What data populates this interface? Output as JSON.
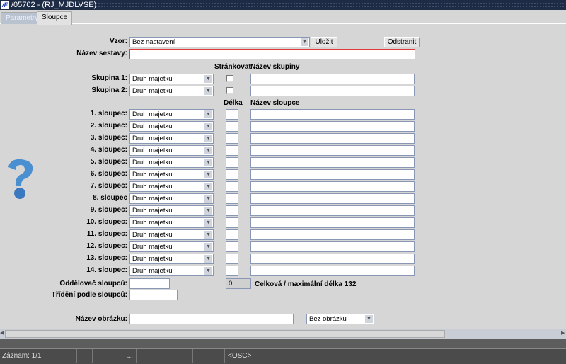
{
  "window": {
    "title": "/05702 - (RJ_MJDLVSE)",
    "logo": "IF"
  },
  "tabs": [
    {
      "label": "Parametry",
      "active": false
    },
    {
      "label": "Sloupce",
      "active": true
    }
  ],
  "form": {
    "vzor_label": "Vzor:",
    "vzor_value": "Bez nastavení",
    "save_label": "Uložit",
    "delete_label": "Odstranit",
    "nazev_sestavy_label": "Název sestavy:",
    "nazev_sestavy_value": "",
    "hdr_strankovat": "Stránkovat",
    "hdr_nazev_skupiny": "Název skupiny",
    "groups": [
      {
        "label": "Skupina 1:",
        "value": "Druh majetku",
        "page": false,
        "name": ""
      },
      {
        "label": "Skupina 2:",
        "value": "Druh majetku",
        "page": false,
        "name": ""
      }
    ],
    "hdr_delka": "Délka",
    "hdr_nazev_sloupce": "Název sloupce",
    "columns": [
      {
        "label": "1. sloupec:",
        "value": "Druh majetku"
      },
      {
        "label": "2. sloupec:",
        "value": "Druh majetku"
      },
      {
        "label": "3. sloupec:",
        "value": "Druh majetku"
      },
      {
        "label": "4. sloupec:",
        "value": "Druh majetku"
      },
      {
        "label": "5. sloupec:",
        "value": "Druh majetku"
      },
      {
        "label": "6. sloupec:",
        "value": "Druh majetku"
      },
      {
        "label": "7. sloupec:",
        "value": "Druh majetku"
      },
      {
        "label": "8. sloupec",
        "value": "Druh majetku"
      },
      {
        "label": "9. sloupec:",
        "value": "Druh majetku"
      },
      {
        "label": "10. sloupec:",
        "value": "Druh majetku"
      },
      {
        "label": "11. sloupec:",
        "value": "Druh majetku"
      },
      {
        "label": "12. sloupec:",
        "value": "Druh majetku"
      },
      {
        "label": "13. sloupec:",
        "value": "Druh majetku"
      },
      {
        "label": "14. sloupec:",
        "value": "Druh majetku"
      }
    ],
    "oddelovac_label": "Oddělovač sloupců:",
    "oddelovac_value": "",
    "celkova_value": "0",
    "celkova_label": "Celková  / maximální délka 132",
    "trideni_label": "Třídění podle sloupců:",
    "trideni_value": "",
    "obrazek_label": "Název obrázku:",
    "obrazek_value": "",
    "obrazek_select": "Bez obrázku"
  },
  "status": {
    "record": "Záznam: 1/1",
    "ellipsis": "...",
    "osc": "<OSC>"
  }
}
